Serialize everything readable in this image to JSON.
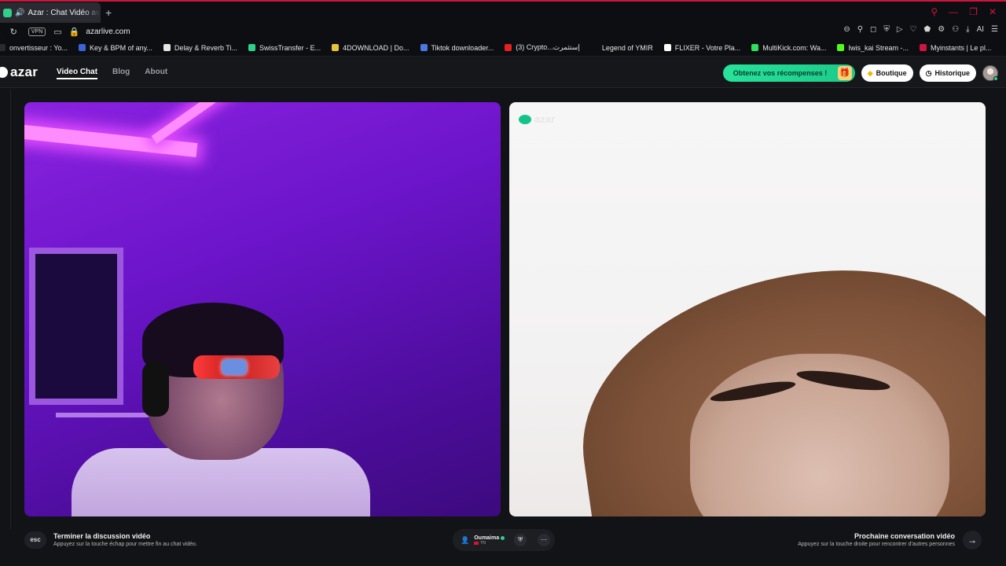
{
  "browser": {
    "tab_title": "Azar : Chat Vidéo avec",
    "speaker_icon": "speaker-icon",
    "new_tab": "+",
    "window_controls": [
      "search-icon",
      "minimize-icon",
      "restore-icon",
      "close-icon"
    ],
    "vpn_label": "VPN",
    "url": "azarlive.com",
    "ai_label": "AI",
    "accent": "#d0143e"
  },
  "bookmarks": [
    {
      "label": "onvertisseur : Yo...",
      "color": "#2a2b31"
    },
    {
      "label": "Key & BPM of any...",
      "color": "#3a64d8"
    },
    {
      "label": "Delay & Reverb Ti...",
      "color": "#e6e6e6"
    },
    {
      "label": "SwissTransfer - E...",
      "color": "#2fd08a"
    },
    {
      "label": "4DOWNLOAD | Do...",
      "color": "#e8c13a"
    },
    {
      "label": "Tiktok downloader...",
      "color": "#4a78e0"
    },
    {
      "label": "(3) Crypto...إستثمرت",
      "color": "#e62020"
    },
    {
      "label": "Legend of YMIR",
      "color": "#0d0e12"
    },
    {
      "label": "FLIXER - Votre Pla...",
      "color": "#ffffff"
    },
    {
      "label": "MultiKick.com: Wa...",
      "color": "#2fe060"
    },
    {
      "label": "Iwis_kai Stream -...",
      "color": "#53fc18"
    },
    {
      "label": "Myinstants | Le pl...",
      "color": "#d0143e"
    }
  ],
  "site": {
    "logo_text": "azar",
    "nav": [
      {
        "label": "Video Chat",
        "active": true
      },
      {
        "label": "Blog",
        "active": false
      },
      {
        "label": "About",
        "active": false
      }
    ],
    "rewards_label": "Obtenez vos récompenses !",
    "shop_label": "Boutique",
    "history_label": "Historique",
    "brand_green": "#26e39b"
  },
  "video": {
    "watermark": "azar"
  },
  "controls": {
    "esc_key": "esc",
    "end_title": "Terminer la discussion vidéo",
    "end_subtitle": "Appuyez sur la touche échap pour mettre fin au chat vidéo.",
    "peer_name": "Oumaima",
    "peer_country": "TN",
    "next_title": "Prochaine conversation vidéo",
    "next_subtitle": "Appuyez sur la touche droite pour rencontrer d'autres personnes",
    "next_arrow": "→"
  }
}
